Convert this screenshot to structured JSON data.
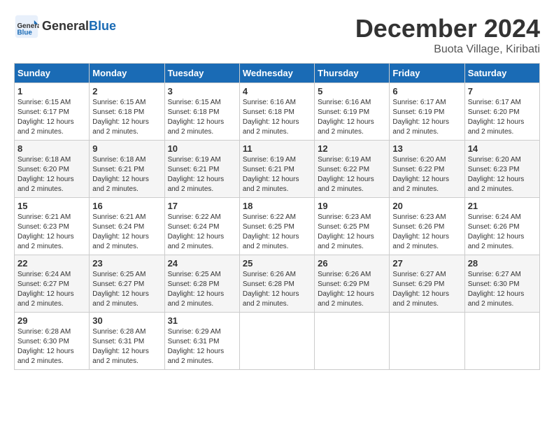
{
  "header": {
    "logo_general": "General",
    "logo_blue": "Blue",
    "title": "December 2024",
    "subtitle": "Buota Village, Kiribati"
  },
  "calendar": {
    "days_of_week": [
      "Sunday",
      "Monday",
      "Tuesday",
      "Wednesday",
      "Thursday",
      "Friday",
      "Saturday"
    ],
    "weeks": [
      [
        null,
        null,
        null,
        null,
        null,
        null,
        null
      ]
    ],
    "cells": [
      {
        "day": 1,
        "col": 0,
        "sunrise": "6:15 AM",
        "sunset": "6:17 PM",
        "daylight": "12 hours and 2 minutes."
      },
      {
        "day": 2,
        "col": 1,
        "sunrise": "6:15 AM",
        "sunset": "6:18 PM",
        "daylight": "12 hours and 2 minutes."
      },
      {
        "day": 3,
        "col": 2,
        "sunrise": "6:15 AM",
        "sunset": "6:18 PM",
        "daylight": "12 hours and 2 minutes."
      },
      {
        "day": 4,
        "col": 3,
        "sunrise": "6:16 AM",
        "sunset": "6:18 PM",
        "daylight": "12 hours and 2 minutes."
      },
      {
        "day": 5,
        "col": 4,
        "sunrise": "6:16 AM",
        "sunset": "6:19 PM",
        "daylight": "12 hours and 2 minutes."
      },
      {
        "day": 6,
        "col": 5,
        "sunrise": "6:17 AM",
        "sunset": "6:19 PM",
        "daylight": "12 hours and 2 minutes."
      },
      {
        "day": 7,
        "col": 6,
        "sunrise": "6:17 AM",
        "sunset": "6:20 PM",
        "daylight": "12 hours and 2 minutes."
      },
      {
        "day": 8,
        "col": 0,
        "sunrise": "6:18 AM",
        "sunset": "6:20 PM",
        "daylight": "12 hours and 2 minutes."
      },
      {
        "day": 9,
        "col": 1,
        "sunrise": "6:18 AM",
        "sunset": "6:21 PM",
        "daylight": "12 hours and 2 minutes."
      },
      {
        "day": 10,
        "col": 2,
        "sunrise": "6:19 AM",
        "sunset": "6:21 PM",
        "daylight": "12 hours and 2 minutes."
      },
      {
        "day": 11,
        "col": 3,
        "sunrise": "6:19 AM",
        "sunset": "6:21 PM",
        "daylight": "12 hours and 2 minutes."
      },
      {
        "day": 12,
        "col": 4,
        "sunrise": "6:19 AM",
        "sunset": "6:22 PM",
        "daylight": "12 hours and 2 minutes."
      },
      {
        "day": 13,
        "col": 5,
        "sunrise": "6:20 AM",
        "sunset": "6:22 PM",
        "daylight": "12 hours and 2 minutes."
      },
      {
        "day": 14,
        "col": 6,
        "sunrise": "6:20 AM",
        "sunset": "6:23 PM",
        "daylight": "12 hours and 2 minutes."
      },
      {
        "day": 15,
        "col": 0,
        "sunrise": "6:21 AM",
        "sunset": "6:23 PM",
        "daylight": "12 hours and 2 minutes."
      },
      {
        "day": 16,
        "col": 1,
        "sunrise": "6:21 AM",
        "sunset": "6:24 PM",
        "daylight": "12 hours and 2 minutes."
      },
      {
        "day": 17,
        "col": 2,
        "sunrise": "6:22 AM",
        "sunset": "6:24 PM",
        "daylight": "12 hours and 2 minutes."
      },
      {
        "day": 18,
        "col": 3,
        "sunrise": "6:22 AM",
        "sunset": "6:25 PM",
        "daylight": "12 hours and 2 minutes."
      },
      {
        "day": 19,
        "col": 4,
        "sunrise": "6:23 AM",
        "sunset": "6:25 PM",
        "daylight": "12 hours and 2 minutes."
      },
      {
        "day": 20,
        "col": 5,
        "sunrise": "6:23 AM",
        "sunset": "6:26 PM",
        "daylight": "12 hours and 2 minutes."
      },
      {
        "day": 21,
        "col": 6,
        "sunrise": "6:24 AM",
        "sunset": "6:26 PM",
        "daylight": "12 hours and 2 minutes."
      },
      {
        "day": 22,
        "col": 0,
        "sunrise": "6:24 AM",
        "sunset": "6:27 PM",
        "daylight": "12 hours and 2 minutes."
      },
      {
        "day": 23,
        "col": 1,
        "sunrise": "6:25 AM",
        "sunset": "6:27 PM",
        "daylight": "12 hours and 2 minutes."
      },
      {
        "day": 24,
        "col": 2,
        "sunrise": "6:25 AM",
        "sunset": "6:28 PM",
        "daylight": "12 hours and 2 minutes."
      },
      {
        "day": 25,
        "col": 3,
        "sunrise": "6:26 AM",
        "sunset": "6:28 PM",
        "daylight": "12 hours and 2 minutes."
      },
      {
        "day": 26,
        "col": 4,
        "sunrise": "6:26 AM",
        "sunset": "6:29 PM",
        "daylight": "12 hours and 2 minutes."
      },
      {
        "day": 27,
        "col": 5,
        "sunrise": "6:27 AM",
        "sunset": "6:29 PM",
        "daylight": "12 hours and 2 minutes."
      },
      {
        "day": 28,
        "col": 6,
        "sunrise": "6:27 AM",
        "sunset": "6:30 PM",
        "daylight": "12 hours and 2 minutes."
      },
      {
        "day": 29,
        "col": 0,
        "sunrise": "6:28 AM",
        "sunset": "6:30 PM",
        "daylight": "12 hours and 2 minutes."
      },
      {
        "day": 30,
        "col": 1,
        "sunrise": "6:28 AM",
        "sunset": "6:31 PM",
        "daylight": "12 hours and 2 minutes."
      },
      {
        "day": 31,
        "col": 2,
        "sunrise": "6:29 AM",
        "sunset": "6:31 PM",
        "daylight": "12 hours and 2 minutes."
      }
    ]
  },
  "labels": {
    "sunrise": "Sunrise: ",
    "sunset": "Sunset: ",
    "daylight": "Daylight: "
  }
}
